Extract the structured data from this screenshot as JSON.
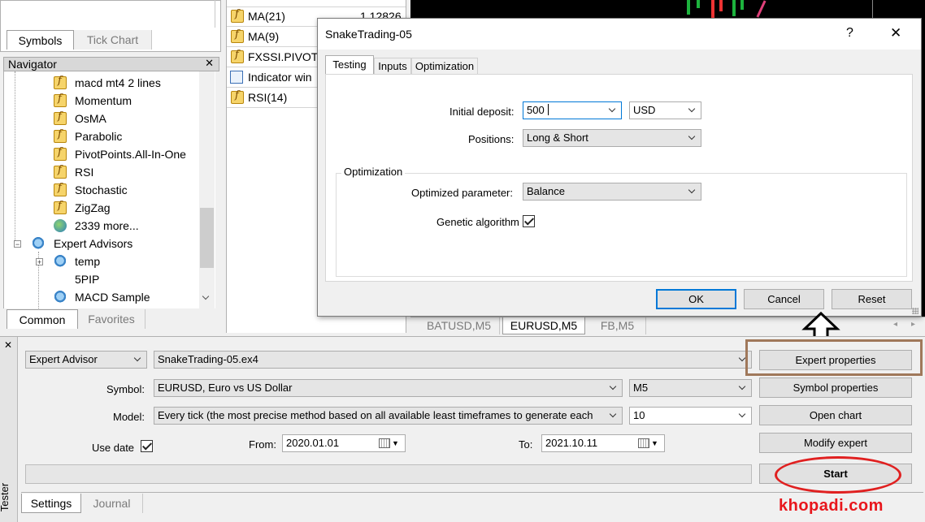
{
  "symbols_tabs": [
    "Symbols",
    "Tick Chart"
  ],
  "navigator": {
    "title": "Navigator",
    "items": [
      {
        "label": "macd mt4 2 lines",
        "icon": "indicator-icon"
      },
      {
        "label": "Momentum",
        "icon": "indicator-icon"
      },
      {
        "label": "OsMA",
        "icon": "indicator-icon"
      },
      {
        "label": "Parabolic",
        "icon": "indicator-icon"
      },
      {
        "label": "PivotPoints.All-In-One",
        "icon": "indicator-icon"
      },
      {
        "label": "RSI",
        "icon": "indicator-icon"
      },
      {
        "label": "Stochastic",
        "icon": "indicator-icon"
      },
      {
        "label": "ZigZag",
        "icon": "indicator-icon"
      },
      {
        "label": "2339 more...",
        "icon": "globe-icon"
      },
      {
        "label": "Expert Advisors",
        "icon": "expert-advisor-icon"
      },
      {
        "label": "temp",
        "icon": "expert-advisor-icon"
      },
      {
        "label": "5PIP",
        "icon": ""
      },
      {
        "label": "MACD Sample",
        "icon": "expert-advisor-icon"
      }
    ],
    "tabs": [
      "Common",
      "Favorites"
    ]
  },
  "data_window": {
    "rows": [
      {
        "name": "MA(21)",
        "value": "1.12826"
      },
      {
        "name": "MA(9)",
        "value": ""
      },
      {
        "name": "FXSSI.PIVOT...",
        "value": ""
      },
      {
        "name": "Indicator win",
        "value": ""
      },
      {
        "name": "RSI(14)",
        "value": ""
      }
    ]
  },
  "chart_tabs": [
    "BATUSD,M5",
    "EURUSD,M5",
    "FB,M5"
  ],
  "dialog": {
    "title": "SnakeTrading-05",
    "help": "?",
    "close": "✕",
    "tabs": [
      "Testing",
      "Inputs",
      "Optimization"
    ],
    "initial_deposit_label": "Initial deposit:",
    "initial_deposit_value": "500",
    "currency": "USD",
    "positions_label": "Positions:",
    "positions_value": "Long & Short",
    "optimization_group": "Optimization",
    "optimized_parameter_label": "Optimized parameter:",
    "optimized_parameter_value": "Balance",
    "genetic_label": "Genetic algorithm",
    "genetic_checked": true,
    "ok": "OK",
    "cancel": "Cancel",
    "reset": "Reset"
  },
  "tester": {
    "side_label": "Tester",
    "close": "✕",
    "type": "Expert Advisor",
    "expert_file": "SnakeTrading-05.ex4",
    "symbol_label": "Symbol:",
    "symbol_value": "EURUSD, Euro vs US Dollar",
    "period_value": "M5",
    "model_label": "Model:",
    "model_value": "Every tick (the most precise method based on all available least timeframes to generate each",
    "spread_value": "10",
    "use_date_label": "Use date",
    "use_date_checked": true,
    "from_label": "From:",
    "from_value": "2020.01.01",
    "to_label": "To:",
    "to_value": "2021.10.11",
    "buttons": {
      "expert_properties": "Expert properties",
      "symbol_properties": "Symbol properties",
      "open_chart": "Open chart",
      "modify_expert": "Modify expert",
      "start": "Start"
    },
    "tabs": [
      "Settings",
      "Journal"
    ]
  },
  "watermark": "khopadi.com",
  "colors": {
    "annotation_red": "#e02020",
    "annotation_brown": "#a0785a",
    "watermark": "#e8161c",
    "accent": "#0078d7"
  }
}
